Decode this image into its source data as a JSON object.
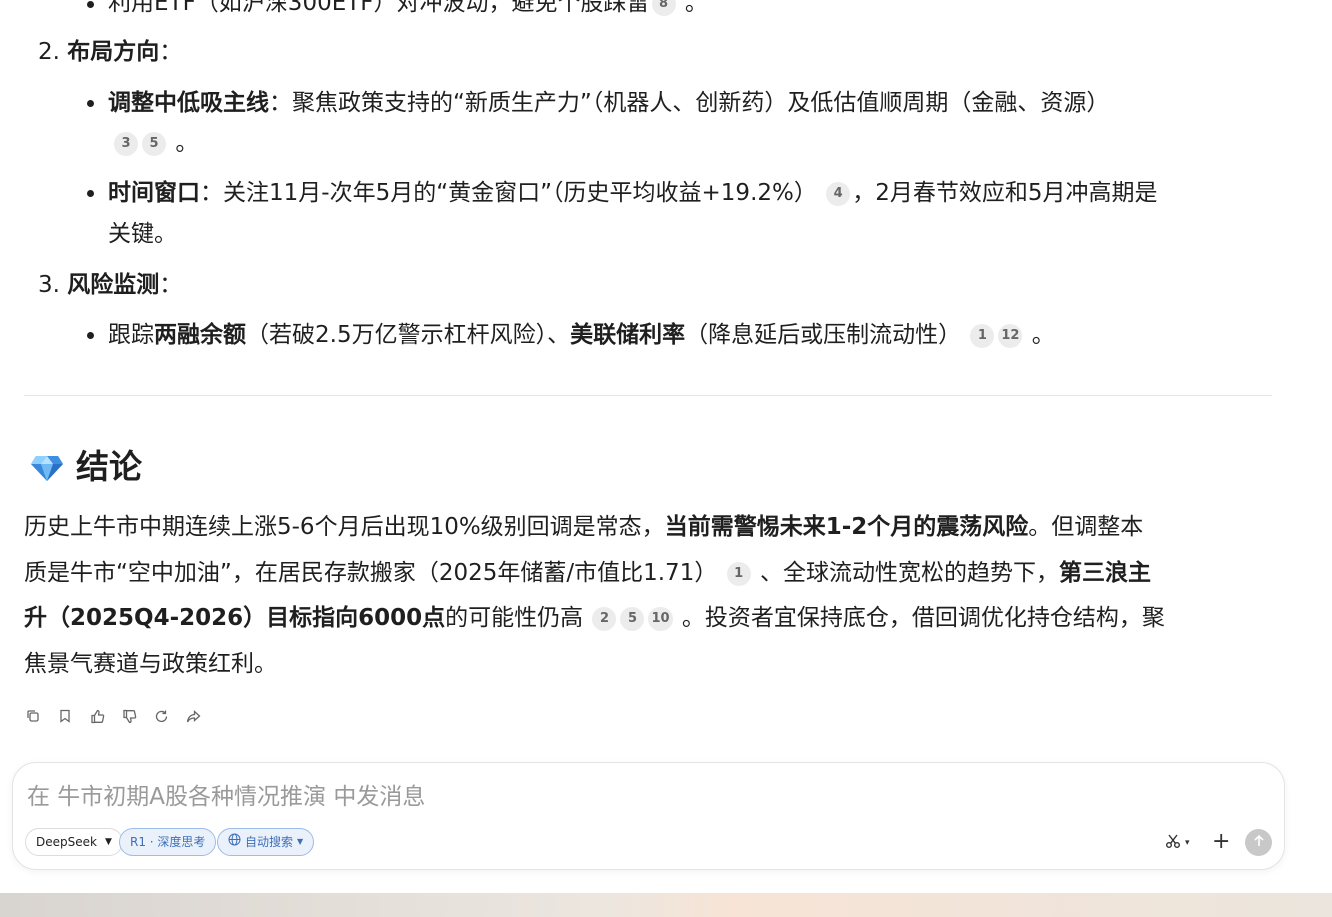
{
  "section_top": {
    "cut_bullet": {
      "text": "利用ETF（如沪深300ETF）对冲波动，避免个股踩雷",
      "cite": "8",
      "end": "。"
    },
    "item2": {
      "num": "2.",
      "title": "布局方向",
      "colon": "："
    },
    "b1": {
      "bold": "调整中低吸主线",
      "text": "：聚焦政策支持的“新质生产力”（机器人、创新药）及低估值顺周期（金融、资源）",
      "cites": [
        "3",
        "5"
      ],
      "end": "。"
    },
    "b2": {
      "bold": "时间窗口",
      "text": "：关注11月-次年5月的“黄金窗口”（历史平均收益+19.2%）",
      "cite": "4",
      "text2": "，2月春节效应和5月冲高期是",
      "text3": "关键。"
    },
    "item3": {
      "num": "3.",
      "title": "风险监测",
      "colon": "："
    },
    "b3": {
      "pre": "跟踪",
      "bold1": "两融余额",
      "mid": "（若破2.5万亿警示杠杆风险）、",
      "bold2": "美联储利率",
      "post": "（降息延后或压制流动性）",
      "cites": [
        "1",
        "12"
      ],
      "end": "。"
    }
  },
  "conclusion": {
    "title": "结论",
    "l1a": "历史上牛市中期连续上涨5-6个月后出现10%级别回调是常态，",
    "l1b": "当前需警惕未来1-2个月的震荡风险",
    "l1c": "。但调整本",
    "l2a": "质是牛市“空中加油”，在居民存款搬家（2025年储蓄/市值比1.71）",
    "c1": "1",
    "l2b": "、全球流动性宽松的趋势下，",
    "l2c": "第三浪主",
    "l3a": "升（2025Q4-2026）目标指向6000点",
    "l3b": "的可能性仍高",
    "c2": "2",
    "c3": "5",
    "c4": "10",
    "l3c": "。投资者宜保持底仓，借回调优化持仓结构，聚",
    "l4": "焦景气赛道与政策红利。"
  },
  "actions": [
    "copy-icon",
    "bookmark-icon",
    "thumbs-up-icon",
    "thumbs-down-icon",
    "regenerate-icon",
    "share-icon"
  ],
  "composer": {
    "placeholder": "在 牛市初期A股各种情况推演 中发消息",
    "model": "DeepSeek",
    "deep_think": "R1 · 深度思考",
    "auto_search": "自动搜索"
  },
  "colors": {
    "accent": "#4a7fc9",
    "chip_bg": "#eaf1fb"
  }
}
